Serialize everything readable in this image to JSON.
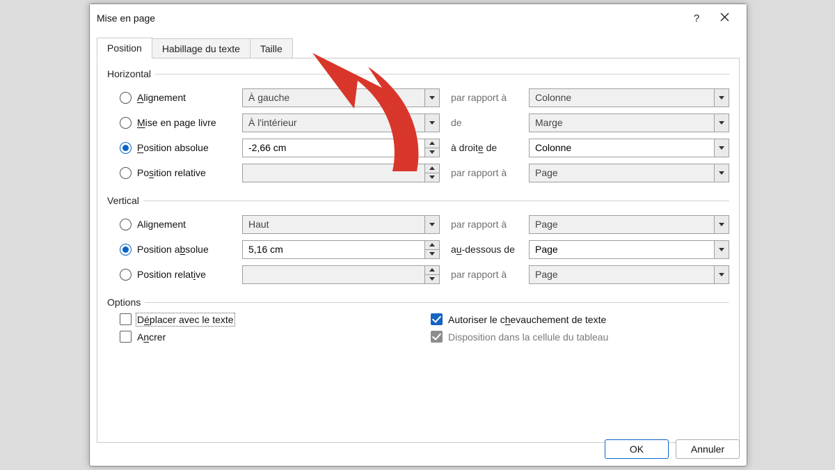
{
  "window": {
    "title": "Mise en page"
  },
  "tabs": {
    "position": "Position",
    "wrap": "Habillage du texte",
    "size": "Taille"
  },
  "horizontal": {
    "legend": "Horizontal",
    "alignment_label_pre": "A",
    "alignment_label_post": "lignement",
    "alignment_value": "À gauche",
    "alignment_rel": "par rapport à",
    "alignment_ref": "Colonne",
    "book_label_pre": "M",
    "book_label_post": "ise en page livre",
    "book_value": "À l'intérieur",
    "book_rel": "de",
    "book_ref": "Marge",
    "abs_label_pre": "P",
    "abs_label_post": "osition absolue",
    "abs_value": "-2,66 cm",
    "abs_rel": "à droit",
    "abs_rel_u": "e",
    "abs_rel_post": " de",
    "abs_ref": "Colonne",
    "relpos_label_pre": "Po",
    "relpos_label_u": "s",
    "relpos_label_post": "ition relative",
    "relpos_rel": "par rapport à",
    "relpos_ref": "Page"
  },
  "vertical": {
    "legend": "Vertical",
    "alignment_label": "Alignement",
    "alignment_value": "Haut",
    "alignment_rel": "par rapport à",
    "alignment_ref": "Page",
    "abs_label_pre": "Position a",
    "abs_label_u": "b",
    "abs_label_post": "solue",
    "abs_value": "5,16 cm",
    "abs_rel_pre": "a",
    "abs_rel_u": "u",
    "abs_rel_post": "-dessous de",
    "abs_ref": "Page",
    "relpos_label_pre": "Position relat",
    "relpos_label_u": "i",
    "relpos_label_post": "ve",
    "relpos_rel": "par rapport à",
    "relpos_ref": "Page"
  },
  "options": {
    "legend": "Options",
    "move_pre": "D",
    "move_u": "é",
    "move_post": "placer avec le texte",
    "lock_pre": "A",
    "lock_u": "n",
    "lock_post": "crer",
    "overlap_pre": "Autoriser le c",
    "overlap_u": "h",
    "overlap_post": "evauchement de texte",
    "cell": "Disposition dans la cellule du tableau"
  },
  "footer": {
    "ok": "OK",
    "cancel": "Annuler"
  }
}
